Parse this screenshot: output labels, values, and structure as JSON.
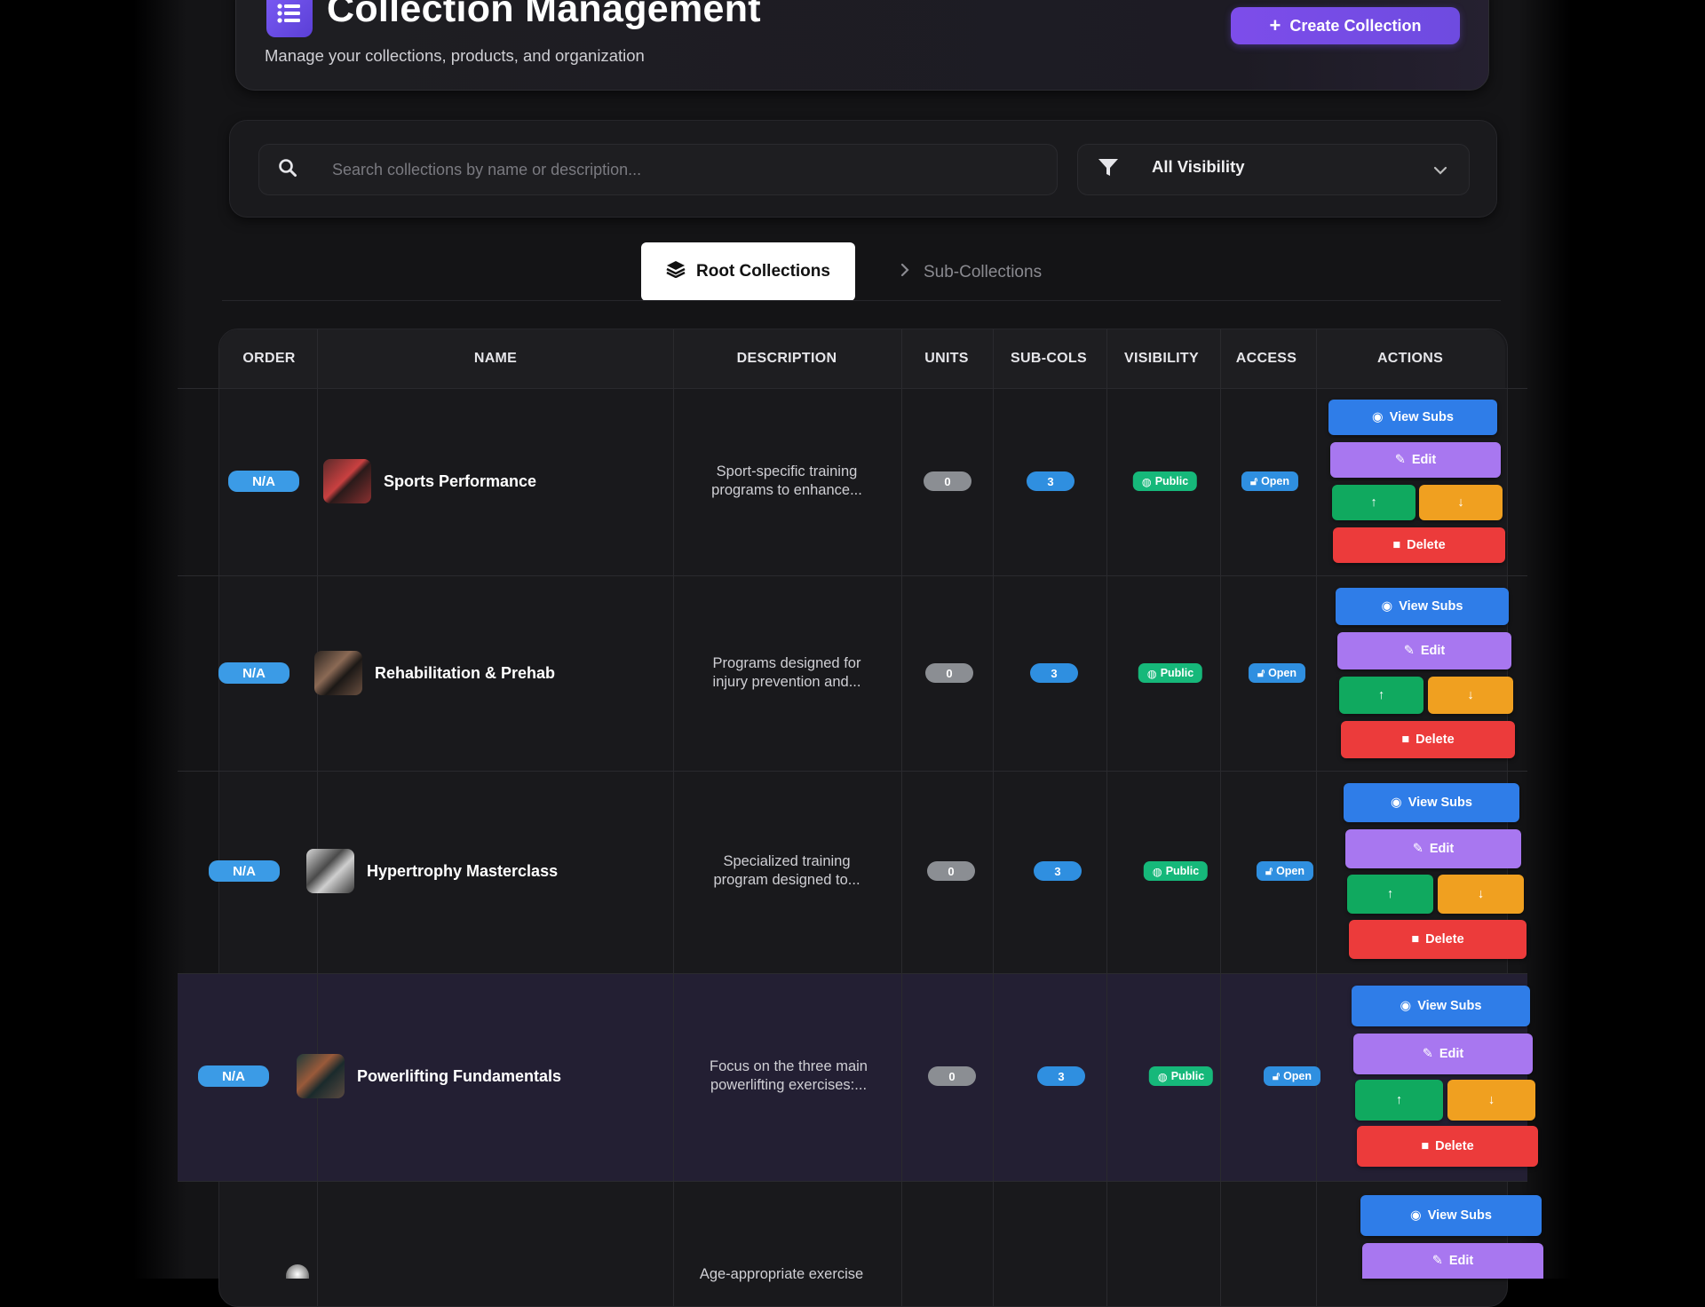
{
  "header": {
    "title": "Collection Management",
    "subtitle": "Manage your collections, products, and organization",
    "create_label": "Create Collection",
    "logo_icon": "list-icon"
  },
  "filters": {
    "search_placeholder": "Search collections by name or description...",
    "search_value": "",
    "visibility_selected": "All Visibility"
  },
  "tabs": {
    "root_label": "Root Collections",
    "sub_label": "Sub-Collections"
  },
  "table": {
    "columns": [
      "ORDER",
      "NAME",
      "DESCRIPTION",
      "UNITS",
      "SUB-COLS",
      "VISIBILITY",
      "ACCESS",
      "ACTIONS"
    ],
    "actions": {
      "view_subs": "View Subs",
      "edit": "Edit",
      "delete": "Delete"
    },
    "rows": [
      {
        "order": "N/A",
        "name": "Sports Performance",
        "desc1": "Sport-specific training",
        "desc2": "programs to enhance...",
        "units": "0",
        "subs": "3",
        "visibility": "Public",
        "access": "Open"
      },
      {
        "order": "N/A",
        "name": "Rehabilitation & Prehab",
        "desc1": "Programs designed for",
        "desc2": "injury prevention and...",
        "units": "0",
        "subs": "3",
        "visibility": "Public",
        "access": "Open"
      },
      {
        "order": "N/A",
        "name": "Hypertrophy Masterclass",
        "desc1": "Specialized training",
        "desc2": "program designed to...",
        "units": "0",
        "subs": "3",
        "visibility": "Public",
        "access": "Open"
      },
      {
        "order": "N/A",
        "name": "Powerlifting Fundamentals",
        "desc1": "Focus on the three main",
        "desc2": "powerlifting exercises:...",
        "units": "0",
        "subs": "3",
        "visibility": "Public",
        "access": "Open"
      },
      {
        "order": "",
        "name": "",
        "desc1": "Age-appropriate exercise",
        "desc2": "",
        "units": "",
        "subs": "",
        "visibility": "",
        "access": ""
      }
    ]
  },
  "colors": {
    "accent": "#7d4dea",
    "view": "#2f7de8",
    "edit": "#a877f0",
    "up": "#10a95f",
    "down": "#f0a020",
    "delete": "#ec3b3b",
    "public": "#16b87a",
    "open": "#2f8fe0"
  }
}
